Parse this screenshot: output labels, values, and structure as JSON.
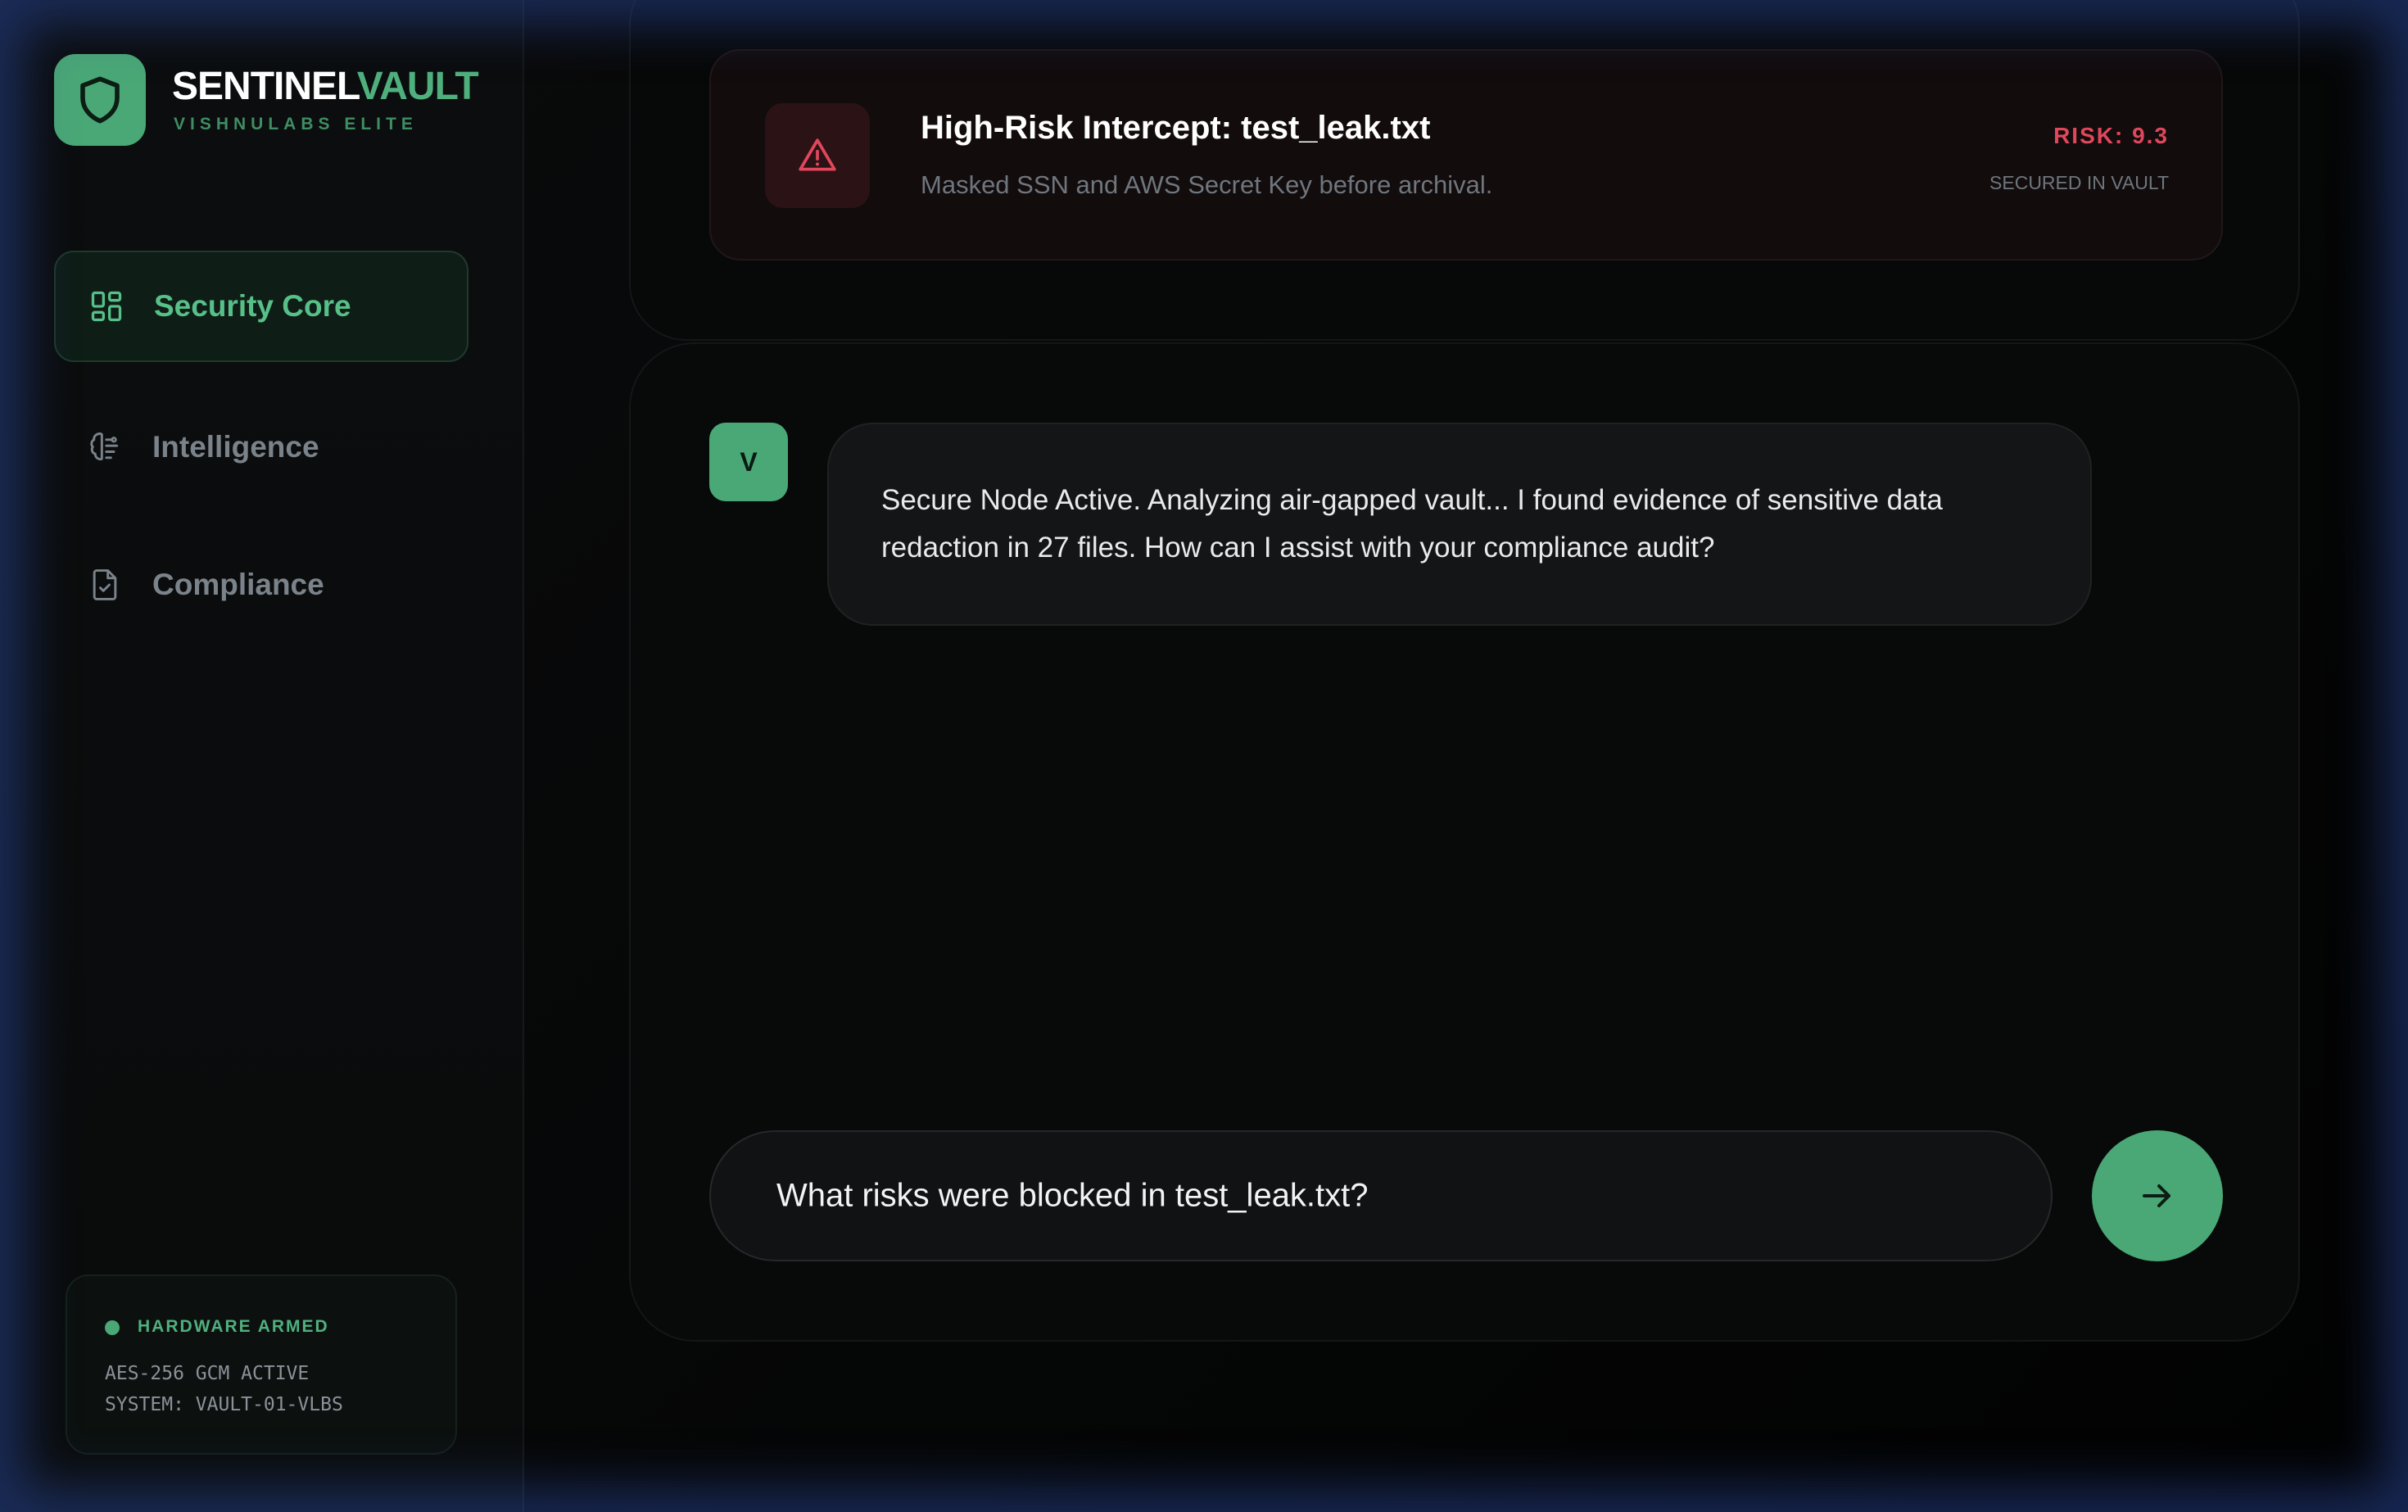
{
  "brand": {
    "name_part1": "SENTINEL",
    "name_part2": "VAULT",
    "subtitle": "VISHNULABS ELITE",
    "logo_icon": "shield-icon"
  },
  "sidebar": {
    "items": [
      {
        "label": "Security Core",
        "icon": "dashboard-grid-icon",
        "active": true
      },
      {
        "label": "Intelligence",
        "icon": "brain-icon",
        "active": false
      },
      {
        "label": "Compliance",
        "icon": "document-check-icon",
        "active": false
      }
    ]
  },
  "hardware": {
    "title": "HARDWARE ARMED",
    "line1": "AES-256 GCM ACTIVE",
    "line2": "SYSTEM: VAULT-01-VLBS"
  },
  "intercept": {
    "title": "High-Risk Intercept: test_leak.txt",
    "subtitle": "Masked SSN and AWS Secret Key before archival.",
    "risk": "RISK: 9.3",
    "status": "SECURED IN VAULT",
    "icon": "warning-triangle-icon"
  },
  "chat": {
    "avatar_letter": "V",
    "message": "Secure Node Active. Analyzing air-gapped vault... I found evidence of sensitive data redaction in 27 files. How can I assist with your compliance audit?"
  },
  "input": {
    "value": "What risks were blocked in test_leak.txt?",
    "send_icon": "arrow-right-icon"
  },
  "colors": {
    "accent": "#4aa876",
    "danger": "#e0475b"
  }
}
